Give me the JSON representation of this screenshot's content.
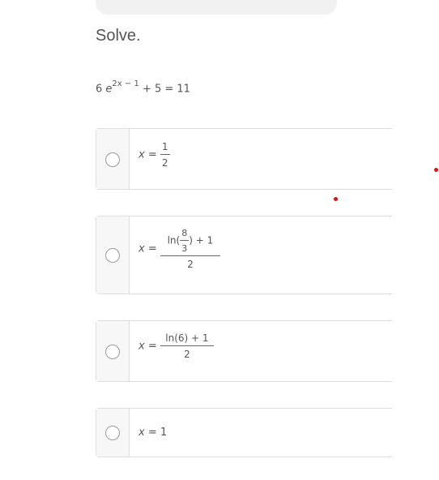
{
  "prompt": "Solve.",
  "equation": {
    "coef": "6",
    "base": "e",
    "exponent": "2x − 1",
    "rest": "+ 5 = 11"
  },
  "choices": [
    {
      "var": "x",
      "eq": "=",
      "num": "1",
      "den": "2"
    },
    {
      "var": "x",
      "eq": "=",
      "ln": "ln",
      "inner_num": "8",
      "inner_den": "3",
      "plus": "+ 1",
      "den": "2"
    },
    {
      "var": "x",
      "eq": "=",
      "num": "ln(6) + 1",
      "den": "2"
    },
    {
      "var": "x",
      "eq": "=",
      "value": "1"
    }
  ],
  "colors": {
    "accent_dot": "#dd1111",
    "border": "#dedede"
  }
}
